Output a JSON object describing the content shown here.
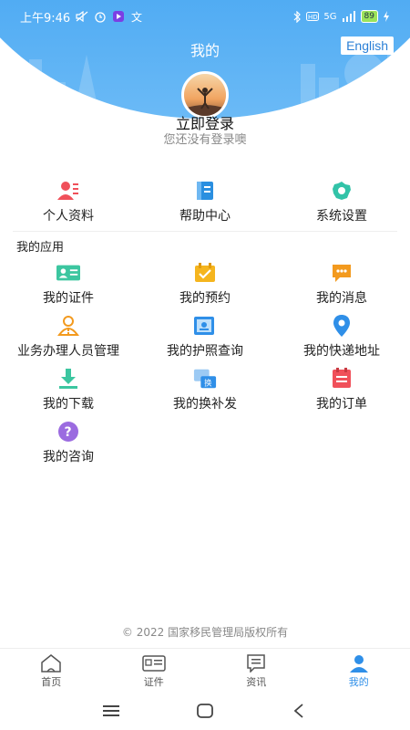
{
  "status_bar": {
    "time": "上午9:46",
    "battery": "89",
    "network": "5G"
  },
  "header": {
    "title": "我的",
    "language_button": "English"
  },
  "profile": {
    "login_title": "立即登录",
    "login_subtitle": "您还没有登录噢"
  },
  "top_actions": [
    {
      "label": "个人资料",
      "icon": "profile-card-icon",
      "color": "#f0505a"
    },
    {
      "label": "帮助中心",
      "icon": "help-book-icon",
      "color": "#2a8fe0"
    },
    {
      "label": "系统设置",
      "icon": "settings-gear-icon",
      "color": "#32c3a8"
    }
  ],
  "apps": {
    "section_title": "我的应用",
    "items": [
      {
        "label": "我的证件",
        "icon": "id-card-icon",
        "color": "#3cc6a0"
      },
      {
        "label": "我的预约",
        "icon": "calendar-check-icon",
        "color": "#f5b51e"
      },
      {
        "label": "我的消息",
        "icon": "message-icon",
        "color": "#f39a1e"
      },
      {
        "label": "业务办理人员管理",
        "icon": "person-warning-icon",
        "color": "#f39a1e"
      },
      {
        "label": "我的护照查询",
        "icon": "passport-icon",
        "color": "#2f8fe8"
      },
      {
        "label": "我的快递地址",
        "icon": "location-pin-icon",
        "color": "#2f8fe8"
      },
      {
        "label": "我的下载",
        "icon": "download-icon",
        "color": "#3cc6a0"
      },
      {
        "label": "我的换补发",
        "icon": "exchange-card-icon",
        "color": "#2f8fe8"
      },
      {
        "label": "我的订单",
        "icon": "order-list-icon",
        "color": "#f0505a"
      },
      {
        "label": "我的咨询",
        "icon": "question-icon",
        "color": "#9b6be0"
      }
    ]
  },
  "footer": {
    "copyright": "© 2022 国家移民管理局版权所有"
  },
  "tabbar": [
    {
      "label": "首页",
      "icon": "home-icon",
      "active": false
    },
    {
      "label": "证件",
      "icon": "id-tab-icon",
      "active": false
    },
    {
      "label": "资讯",
      "icon": "news-icon",
      "active": false
    },
    {
      "label": "我的",
      "icon": "user-icon",
      "active": true
    }
  ],
  "colors": {
    "primary": "#2f8fe8",
    "text": "#222222",
    "muted": "#888888"
  }
}
